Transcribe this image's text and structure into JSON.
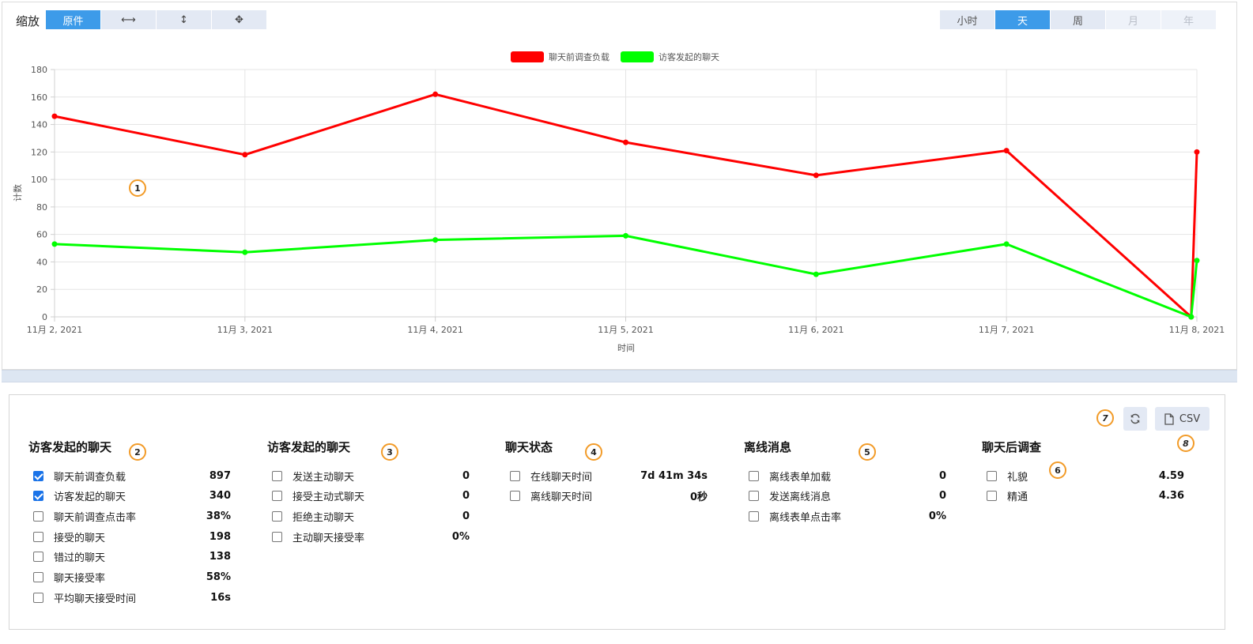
{
  "toolbar": {
    "zoom_label": "缩放",
    "zoom_buttons": [
      {
        "label": "原件",
        "active": true
      },
      {
        "label": "⟷",
        "icon": "horizontal-arrows-icon"
      },
      {
        "label": "↕",
        "icon": "vertical-arrows-icon"
      },
      {
        "label": "✥",
        "icon": "move-arrows-icon"
      }
    ],
    "period_buttons": [
      {
        "label": "小时",
        "state": "normal"
      },
      {
        "label": "天",
        "state": "active"
      },
      {
        "label": "周",
        "state": "normal"
      },
      {
        "label": "月",
        "state": "disabled"
      },
      {
        "label": "年",
        "state": "disabled"
      }
    ]
  },
  "chart_data": {
    "type": "line",
    "categories": [
      "11月 2, 2021",
      "11月 3, 2021",
      "11月 4, 2021",
      "11月 5, 2021",
      "11月 6, 2021",
      "11月 7, 2021",
      "11月 8, 2021"
    ],
    "x_days": [
      0,
      1,
      2,
      3,
      4,
      5,
      5.97,
      6
    ],
    "series": [
      {
        "name": "聊天前调查负载",
        "color": "#ff0000",
        "values": [
          146,
          118,
          162,
          127,
          103,
          121,
          0,
          120
        ]
      },
      {
        "name": "访客发起的聊天",
        "color": "#00ff00",
        "values": [
          53,
          47,
          56,
          59,
          31,
          53,
          0,
          41
        ]
      }
    ],
    "xlabel": "时间",
    "ylabel": "计数",
    "ylim": [
      0,
      180
    ],
    "yticks": [
      0,
      20,
      40,
      60,
      80,
      100,
      120,
      140,
      160,
      180
    ],
    "grid": true,
    "legend_position": "top-center"
  },
  "annotation_badges": [
    "1",
    "2",
    "3",
    "4",
    "5",
    "6",
    "7",
    "8"
  ],
  "actions": {
    "refresh_icon": "refresh-icon",
    "csv_icon": "file-icon",
    "csv_label": "CSV"
  },
  "stats": {
    "visitor_chats": {
      "title": "访客发起的聊天",
      "rows": [
        {
          "label": "聊天前调查负载",
          "value": "897",
          "checked": true
        },
        {
          "label": "访客发起的聊天",
          "value": "340",
          "checked": true
        },
        {
          "label": "聊天前调查点击率",
          "value": "38%",
          "checked": false
        },
        {
          "label": "接受的聊天",
          "value": "198",
          "checked": false
        },
        {
          "label": "错过的聊天",
          "value": "138",
          "checked": false
        },
        {
          "label": "聊天接受率",
          "value": "58%",
          "checked": false
        },
        {
          "label": "平均聊天接受时间",
          "value": "16s",
          "checked": false
        }
      ]
    },
    "proactive_chats": {
      "title": "访客发起的聊天",
      "rows": [
        {
          "label": "发送主动聊天",
          "value": "0",
          "checked": false
        },
        {
          "label": "接受主动式聊天",
          "value": "0",
          "checked": false
        },
        {
          "label": "拒绝主动聊天",
          "value": "0",
          "checked": false
        },
        {
          "label": "主动聊天接受率",
          "value": "0%",
          "checked": false
        }
      ]
    },
    "chat_status": {
      "title": "聊天状态",
      "rows": [
        {
          "label": "在线聊天时间",
          "value": "7d 41m 34s",
          "checked": false
        },
        {
          "label": "离线聊天时间",
          "value": "0秒",
          "checked": false
        }
      ]
    },
    "offline_messages": {
      "title": "离线消息",
      "rows": [
        {
          "label": "离线表单加载",
          "value": "0",
          "checked": false
        },
        {
          "label": "发送离线消息",
          "value": "0",
          "checked": false
        },
        {
          "label": "离线表单点击率",
          "value": "0%",
          "checked": false
        }
      ]
    },
    "post_chat_survey": {
      "title": "聊天后调查",
      "rows": [
        {
          "label": "礼貌",
          "value": "4.59",
          "checked": false
        },
        {
          "label": "精通",
          "value": "4.36",
          "checked": false
        }
      ]
    }
  }
}
